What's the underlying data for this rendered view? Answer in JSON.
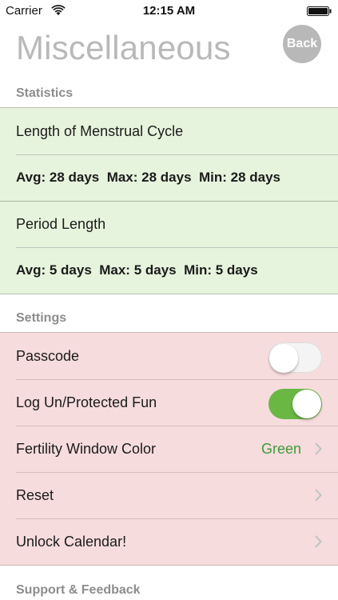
{
  "status_bar": {
    "carrier": "Carrier",
    "time": "12:15 AM"
  },
  "header": {
    "title": "Miscellaneous",
    "back_label": "Back"
  },
  "sections": {
    "statistics": "Statistics",
    "settings": "Settings",
    "support": "Support & Feedback"
  },
  "statistics": {
    "cycle_label": "Length of Menstrual Cycle",
    "cycle_stats": "Avg: 28 days  Max: 28 days  Min: 28 days",
    "period_label": "Period Length",
    "period_stats": "Avg: 5 days  Max: 5 days  Min: 5 days"
  },
  "settings": {
    "passcode_label": "Passcode",
    "passcode_on": false,
    "log_label": "Log Un/Protected Fun",
    "log_on": true,
    "fertility_label": "Fertility Window Color",
    "fertility_value": "Green",
    "reset_label": "Reset",
    "unlock_label": "Unlock Calendar!"
  },
  "colors": {
    "stats_bg": "#e6f4dd",
    "settings_bg": "#f6dcdd",
    "toggle_on": "#6ab744",
    "value_green": "#3f9a3a"
  },
  "icons": [
    "wifi-icon",
    "battery-icon",
    "chevron-right-icon"
  ]
}
